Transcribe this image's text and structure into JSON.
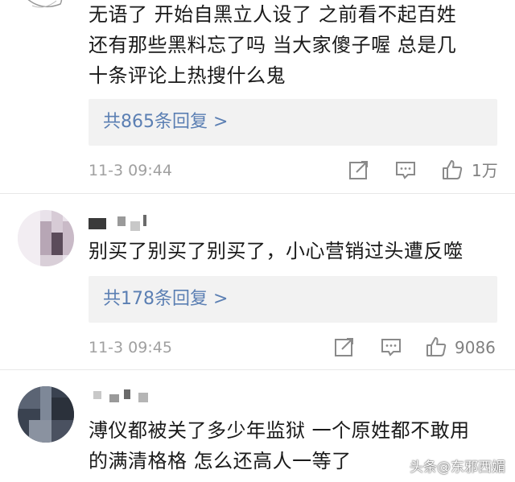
{
  "comments": [
    {
      "text": "无语了 开始自黑立人设了 之前看不起百姓\n还有那些黑料忘了吗 当大家傻子喔 总是几\n十条评论上热搜什么鬼",
      "replies": "共865条回复 >",
      "time": "11-3 09:44",
      "likes": "1万"
    },
    {
      "text": "别买了别买了别买了，小心营销过头遭反噬",
      "replies": "共178条回复 >",
      "time": "11-3 09:45",
      "likes": "9086"
    },
    {
      "text": "溥仪都被关了多少年监狱 一个原姓都不敢用\n的满清格格 怎么还高人一等了"
    }
  ],
  "watermark": "头条@东邪西媚",
  "colors": {
    "reply_link": "#5b7fb3",
    "meta_gray": "#a0a0a0",
    "reply_bg": "#f2f2f2"
  },
  "icons": [
    "repost-icon",
    "comment-icon",
    "like-icon"
  ]
}
